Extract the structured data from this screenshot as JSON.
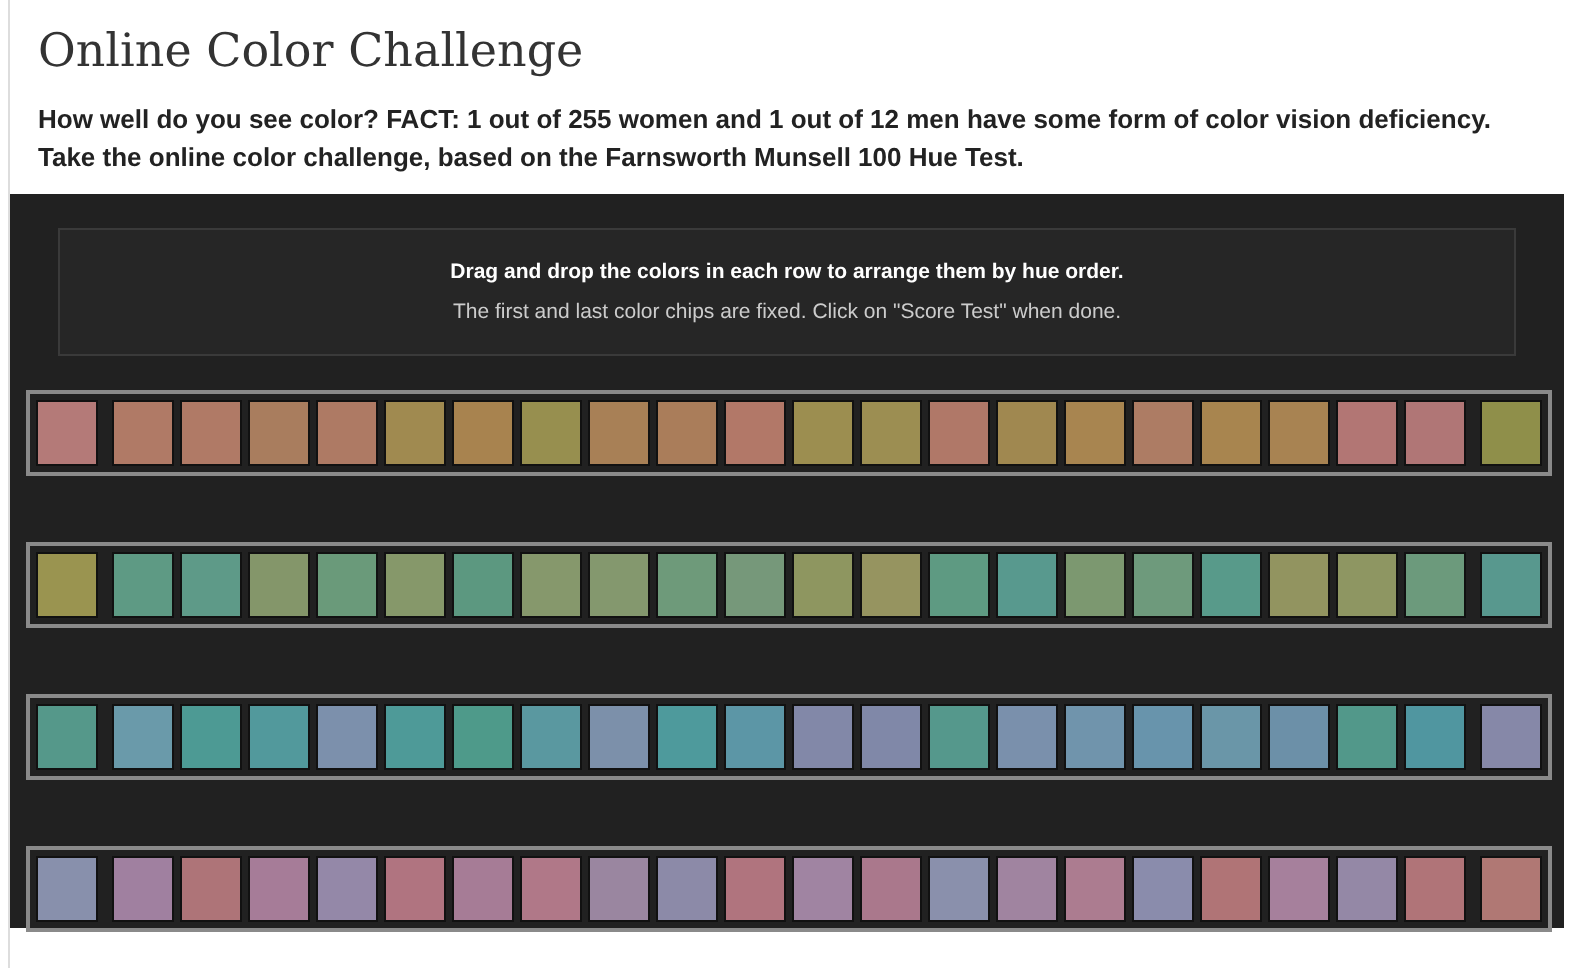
{
  "title": "Online Color Challenge",
  "intro": [
    "How well do you see color? FACT: 1 out of 255 women and 1 out of 12 men have some form of color vision deficiency.",
    "Take the online color challenge, based on the Farnsworth Munsell 100 Hue Test."
  ],
  "instructions": {
    "heading": "Drag and drop the colors in each row to arrange them by hue order.",
    "note": "The first and last color chips are fixed. Click on \"Score Test\" when done."
  },
  "rows": [
    {
      "chips": [
        {
          "color": "#b47a78"
        },
        {
          "color": "#b07a66"
        },
        {
          "color": "#b07a66"
        },
        {
          "color": "#a97d5e"
        },
        {
          "color": "#ae7a64"
        },
        {
          "color": "#a08a50"
        },
        {
          "color": "#a8834f"
        },
        {
          "color": "#978f4f"
        },
        {
          "color": "#a88056"
        },
        {
          "color": "#aa7d5a"
        },
        {
          "color": "#b27868"
        },
        {
          "color": "#9c8e50"
        },
        {
          "color": "#9c8e52"
        },
        {
          "color": "#b07868"
        },
        {
          "color": "#a08850"
        },
        {
          "color": "#a88550"
        },
        {
          "color": "#ad7c64"
        },
        {
          "color": "#a8854f"
        },
        {
          "color": "#a88352"
        },
        {
          "color": "#b27674"
        },
        {
          "color": "#b07676"
        },
        {
          "color": "#8f8f4a"
        }
      ]
    },
    {
      "chips": [
        {
          "color": "#9a9450"
        },
        {
          "color": "#5e9a84"
        },
        {
          "color": "#5e9a88"
        },
        {
          "color": "#84966a"
        },
        {
          "color": "#6a9a7a"
        },
        {
          "color": "#86986a"
        },
        {
          "color": "#5c9880"
        },
        {
          "color": "#86986c"
        },
        {
          "color": "#84986e"
        },
        {
          "color": "#6e9a7a"
        },
        {
          "color": "#76987a"
        },
        {
          "color": "#8e9660"
        },
        {
          "color": "#969460"
        },
        {
          "color": "#5e9a82"
        },
        {
          "color": "#58998e"
        },
        {
          "color": "#7c9870"
        },
        {
          "color": "#6e9a7c"
        },
        {
          "color": "#589a8a"
        },
        {
          "color": "#929460"
        },
        {
          "color": "#8e9662"
        },
        {
          "color": "#6c9a7c"
        },
        {
          "color": "#58988e"
        }
      ]
    },
    {
      "chips": [
        {
          "color": "#55988a"
        },
        {
          "color": "#6a9aaa"
        },
        {
          "color": "#4d9a94"
        },
        {
          "color": "#52999c"
        },
        {
          "color": "#7c90ac"
        },
        {
          "color": "#4e9a98"
        },
        {
          "color": "#4e9a8a"
        },
        {
          "color": "#5a98a0"
        },
        {
          "color": "#7c90aa"
        },
        {
          "color": "#4e9a9c"
        },
        {
          "color": "#5c96a6"
        },
        {
          "color": "#8288a8"
        },
        {
          "color": "#8088a8"
        },
        {
          "color": "#55988c"
        },
        {
          "color": "#7a90ac"
        },
        {
          "color": "#7094ac"
        },
        {
          "color": "#6894ac"
        },
        {
          "color": "#6a96a8"
        },
        {
          "color": "#6c90a8"
        },
        {
          "color": "#52988a"
        },
        {
          "color": "#5096a0"
        },
        {
          "color": "#8688a8"
        }
      ]
    },
    {
      "chips": [
        {
          "color": "#8890ac"
        },
        {
          "color": "#a080a0"
        },
        {
          "color": "#ae7478"
        },
        {
          "color": "#a67c98"
        },
        {
          "color": "#9488a8"
        },
        {
          "color": "#b07480"
        },
        {
          "color": "#a67c96"
        },
        {
          "color": "#b07888"
        },
        {
          "color": "#9a86a0"
        },
        {
          "color": "#8c8aa8"
        },
        {
          "color": "#b0747e"
        },
        {
          "color": "#a084a2"
        },
        {
          "color": "#aa788c"
        },
        {
          "color": "#8a90ac"
        },
        {
          "color": "#a084a0"
        },
        {
          "color": "#ac7c90"
        },
        {
          "color": "#8a8cac"
        },
        {
          "color": "#b07476"
        },
        {
          "color": "#a6809c"
        },
        {
          "color": "#9488a6"
        },
        {
          "color": "#b07478"
        },
        {
          "color": "#b07874"
        }
      ]
    }
  ]
}
